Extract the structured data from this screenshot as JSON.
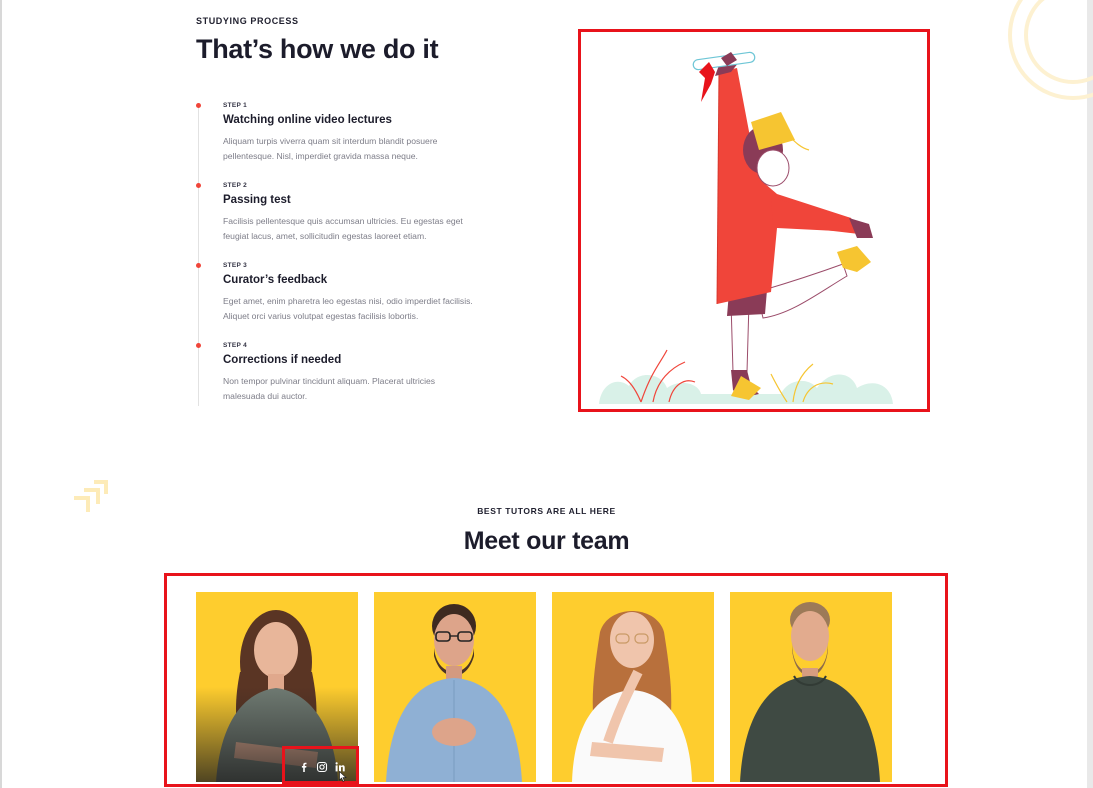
{
  "process": {
    "eyebrow": "STUDYING PROCESS",
    "title": "That’s how we do it",
    "steps": [
      {
        "number": "STEP 1",
        "title": "Watching online video lectures",
        "text": "Aliquam turpis viverra quam sit interdum blandit posuere pellentesque. Nisl, imperdiet gravida massa neque."
      },
      {
        "number": "STEP 2",
        "title": "Passing test",
        "text": "Facilisis pellentesque quis accumsan ultricies. Eu egestas eget feugiat lacus, amet, sollicitudin egestas laoreet etiam."
      },
      {
        "number": "STEP 3",
        "title": "Curator’s feedback",
        "text": "Eget amet, enim pharetra leo egestas nisi, odio imperdiet facilisis. Aliquet orci varius volutpat egestas facilisis lobortis."
      },
      {
        "number": "STEP 4",
        "title": "Corrections if needed",
        "text": "Non tempor pulvinar tincidunt aliquam. Placerat ultricies malesuada dui auctor."
      }
    ]
  },
  "team": {
    "eyebrow": "BEST TUTORS ARE ALL HERE",
    "title": "Meet our team",
    "social_icons": [
      "facebook-icon",
      "instagram-icon",
      "linkedin-icon"
    ]
  },
  "colors": {
    "accent_red": "#f0453a",
    "card_yellow": "#fecd2e",
    "highlight_border": "#e8131b"
  }
}
